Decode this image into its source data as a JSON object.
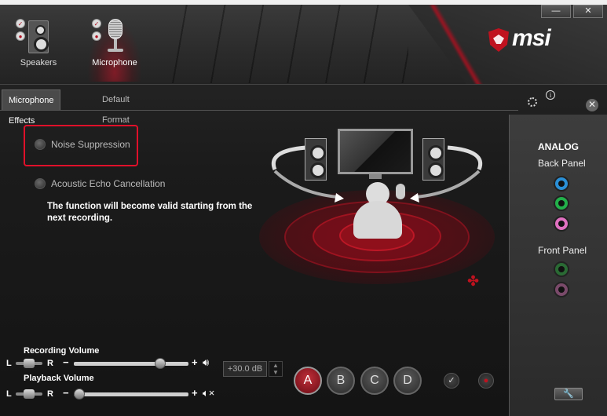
{
  "devices": [
    {
      "label": "Speakers",
      "icon": "speaker-icon"
    },
    {
      "label": "Microphone",
      "icon": "microphone-icon"
    }
  ],
  "brand": {
    "name": "msi",
    "color": "#c0121f"
  },
  "window": {
    "minimize": "—",
    "close": "✕"
  },
  "tabs": [
    {
      "label": "Microphone Effects",
      "active": true
    },
    {
      "label": "Default Format",
      "active": false
    }
  ],
  "effects": {
    "noise_suppression": "Noise Suppression",
    "echo_cancellation": "Acoustic Echo Cancellation",
    "notice": "The function will become valid starting from the next recording."
  },
  "right_panel": {
    "title": "ANALOG",
    "back_panel": "Back Panel",
    "front_panel": "Front Panel",
    "back_jacks": [
      "#2a8fd6",
      "#22b04a",
      "#e070c0"
    ],
    "front_jacks": [
      "#2a6a34",
      "#7a4a6a"
    ]
  },
  "recording": {
    "title": "Recording Volume",
    "left": "L",
    "right": "R",
    "minus": "−",
    "plus": "+",
    "level": 0.78,
    "db": "+30.0 dB"
  },
  "playback": {
    "title": "Playback Volume",
    "left": "L",
    "right": "R",
    "minus": "−",
    "plus": "+",
    "level": 0.0
  },
  "presets": [
    "A",
    "B",
    "C",
    "D"
  ],
  "active_preset": "A"
}
